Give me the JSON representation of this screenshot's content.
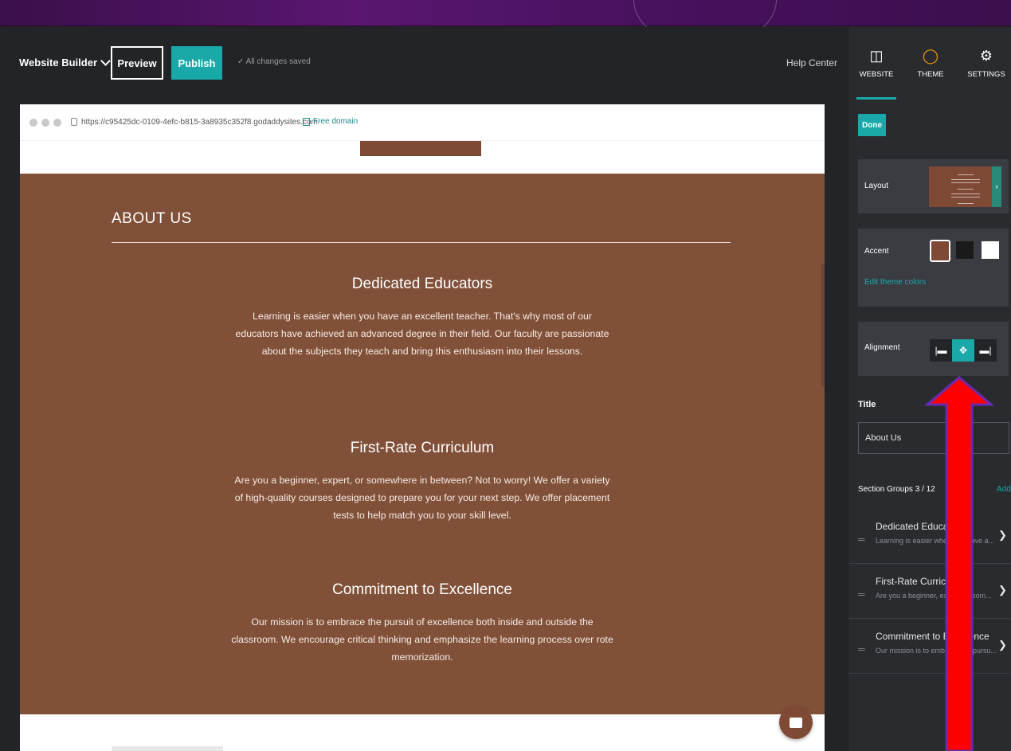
{
  "toolbar": {
    "brand_label": "Website Builder",
    "preview_label": "Preview",
    "publish_label": "Publish",
    "save_status": "✓  All changes saved",
    "help_label": "Help Center"
  },
  "browser": {
    "url": "https://c95425dc-0109-4efc-b815-3a8935c352f8.godaddysites.com",
    "free_domain": "Free domain"
  },
  "about": {
    "heading": "ABOUT US",
    "groups": [
      {
        "title": "Dedicated Educators",
        "body": "Learning is easier when you have an excellent teacher. That's why most of our educators have achieved an advanced degree in their field. Our faculty are passionate about the subjects they teach and bring this enthusiasm into their lessons."
      },
      {
        "title": "First-Rate Curriculum",
        "body": "Are you a beginner, expert, or somewhere in between? Not to worry! We offer a variety of high-quality courses designed to prepare you for your next step. We offer placement tests to help match you to your skill level."
      },
      {
        "title": "Commitment to Excellence",
        "body": "Our mission is to embrace the pursuit of excellence both inside and outside the classroom. We encourage critical thinking and emphasize the learning process over rote memorization."
      }
    ]
  },
  "panel": {
    "tabs": [
      {
        "label": "WEBSITE",
        "icon": "window-icon"
      },
      {
        "label": "THEME",
        "icon": "color-ring-icon"
      },
      {
        "label": "SETTINGS",
        "icon": "gear-icon"
      }
    ],
    "done_label": "Done",
    "layout_label": "Layout",
    "accent_label": "Accent",
    "accent_colors": [
      "#7e4a35",
      "#1a1a1a",
      "#ffffff"
    ],
    "edit_theme_label": "Edit theme colors",
    "alignment_label": "Alignment",
    "alignment_selected": "center",
    "title_label": "Title",
    "title_value": "About Us",
    "groups_label": "Section Groups 3 / 12",
    "add_label": "Add",
    "group_rows": [
      {
        "title": "Dedicated Educators",
        "summary": "Learning is easier when you have a..."
      },
      {
        "title": "First-Rate Curriculum",
        "summary": "Are you a beginner, expert, or som..."
      },
      {
        "title": "Commitment to Excellence",
        "summary": "Our mission is to embrace the pursu..."
      }
    ]
  },
  "colors": {
    "accent": "#1aa8a8",
    "section_bg": "#815038",
    "annotation_arrow": "#ff0000"
  }
}
